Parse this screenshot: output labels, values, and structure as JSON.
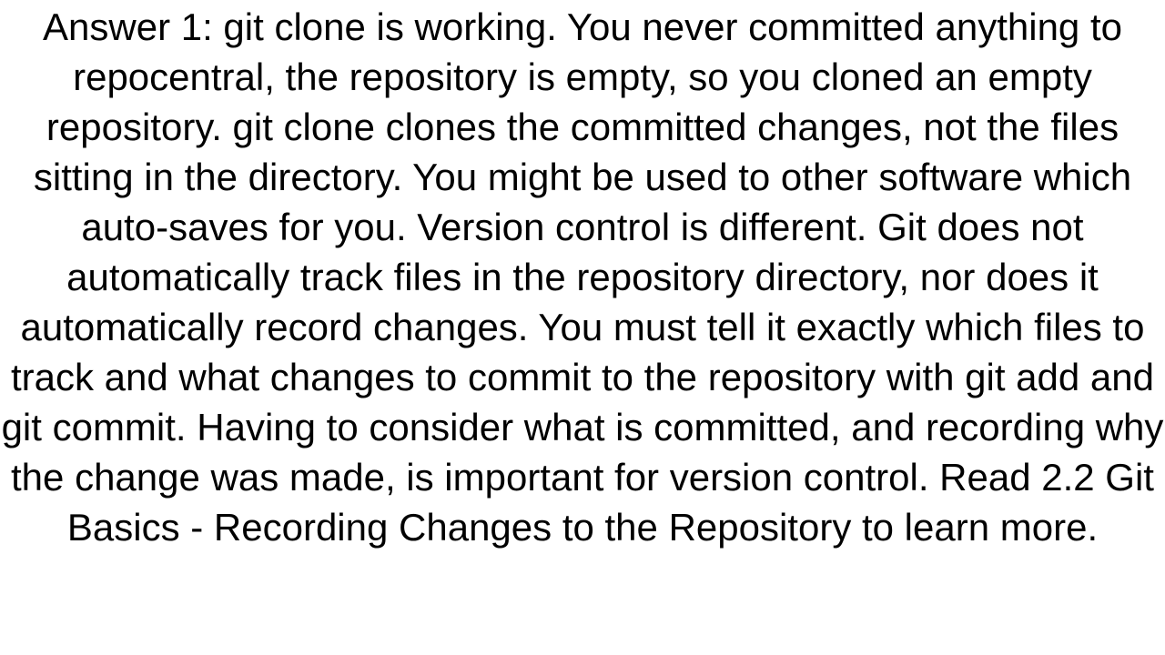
{
  "answer": {
    "label": "Answer 1:",
    "text": "Answer 1: git clone is working. You never committed anything to repocentral, the repository is empty, so you cloned an empty repository. git clone clones the committed changes, not the files sitting in the directory. You might be used to other software which auto-saves for you. Version control is different. Git does not automatically track files in the repository directory, nor does it automatically record changes. You must tell it exactly which files to track and what changes to commit to the repository with git add and git commit. Having to consider what is committed, and recording why the change was made, is important for version control. Read 2.2 Git Basics - Recording Changes to the Repository to learn more."
  }
}
